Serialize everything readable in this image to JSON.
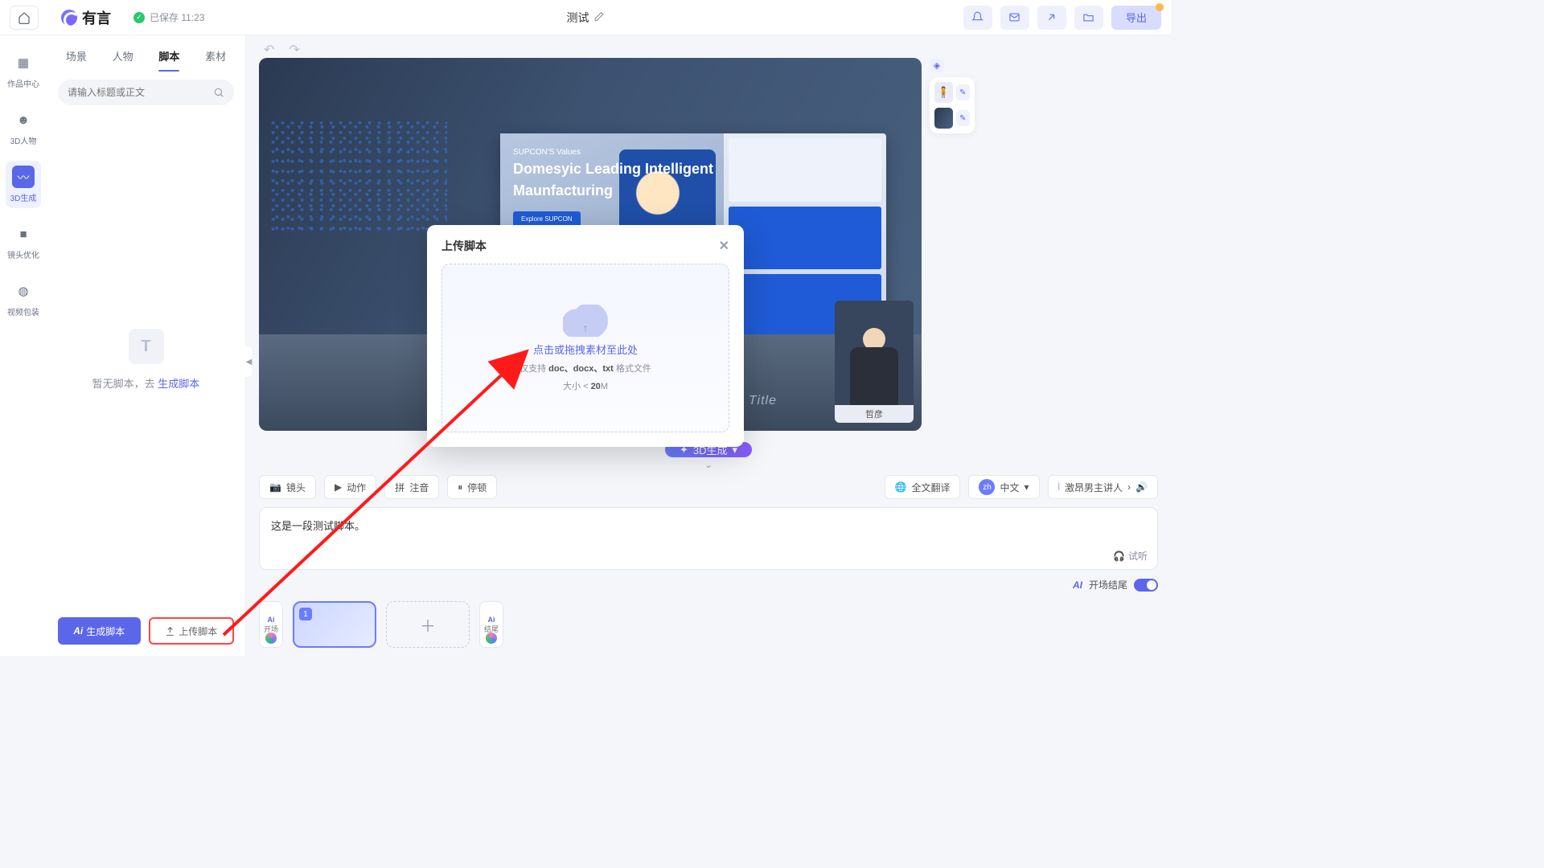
{
  "topbar": {
    "logo_text": "有言",
    "saved_label": "已保存 11:23",
    "doc_title": "测试",
    "export_label": "导出"
  },
  "rail": {
    "items": [
      {
        "label": "作品中心",
        "icon": "grid-icon"
      },
      {
        "label": "3D人物",
        "icon": "person-icon"
      },
      {
        "label": "3D生成",
        "icon": "wave-icon"
      },
      {
        "label": "镜头优化",
        "icon": "camera-icon"
      },
      {
        "label": "视频包装",
        "icon": "package-icon"
      }
    ]
  },
  "left_panel": {
    "tabs": [
      "场景",
      "人物",
      "脚本",
      "素材"
    ],
    "search_placeholder": "请输入标题或正文",
    "no_script_prefix": "暂无脚本，去 ",
    "no_script_link": "生成脚本",
    "btn_generate": "生成脚本",
    "btn_upload": "上传脚本",
    "ai_prefix": "Ai"
  },
  "canvas": {
    "wall_subtitle": "SUPCON'S Values",
    "wall_title_1": "Domesyic Leading Intelligent",
    "wall_title_2": "Maunfacturing",
    "wall_btn": "Explore SUPCON",
    "news_title": "News Program Title",
    "avatar_name": "哲彦",
    "gen_label": "3D生成"
  },
  "toolbar": {
    "chips": [
      "镜头",
      "动作",
      "注音",
      "停顿"
    ],
    "translate": "全文翻译",
    "lang_badge": "zh",
    "lang_text": "中文",
    "voice_label": "激昂男主讲人"
  },
  "script": {
    "text": "这是一段测试脚本。",
    "listen": "试听"
  },
  "opening": {
    "ai": "AI",
    "label": "开场结尾"
  },
  "timeline": {
    "ai": "Ai",
    "open": "开场",
    "close": "结尾",
    "scene_num": "1"
  },
  "modal": {
    "title": "上传脚本",
    "dz_main": "点击或拖拽素材至此处",
    "dz_sub_prefix": "仅支持 ",
    "dz_formats": "doc、docx、txt",
    "dz_sub_suffix": " 格式文件",
    "dz_size_prefix": "大小 < ",
    "dz_size": "20",
    "dz_size_suffix": "M"
  }
}
